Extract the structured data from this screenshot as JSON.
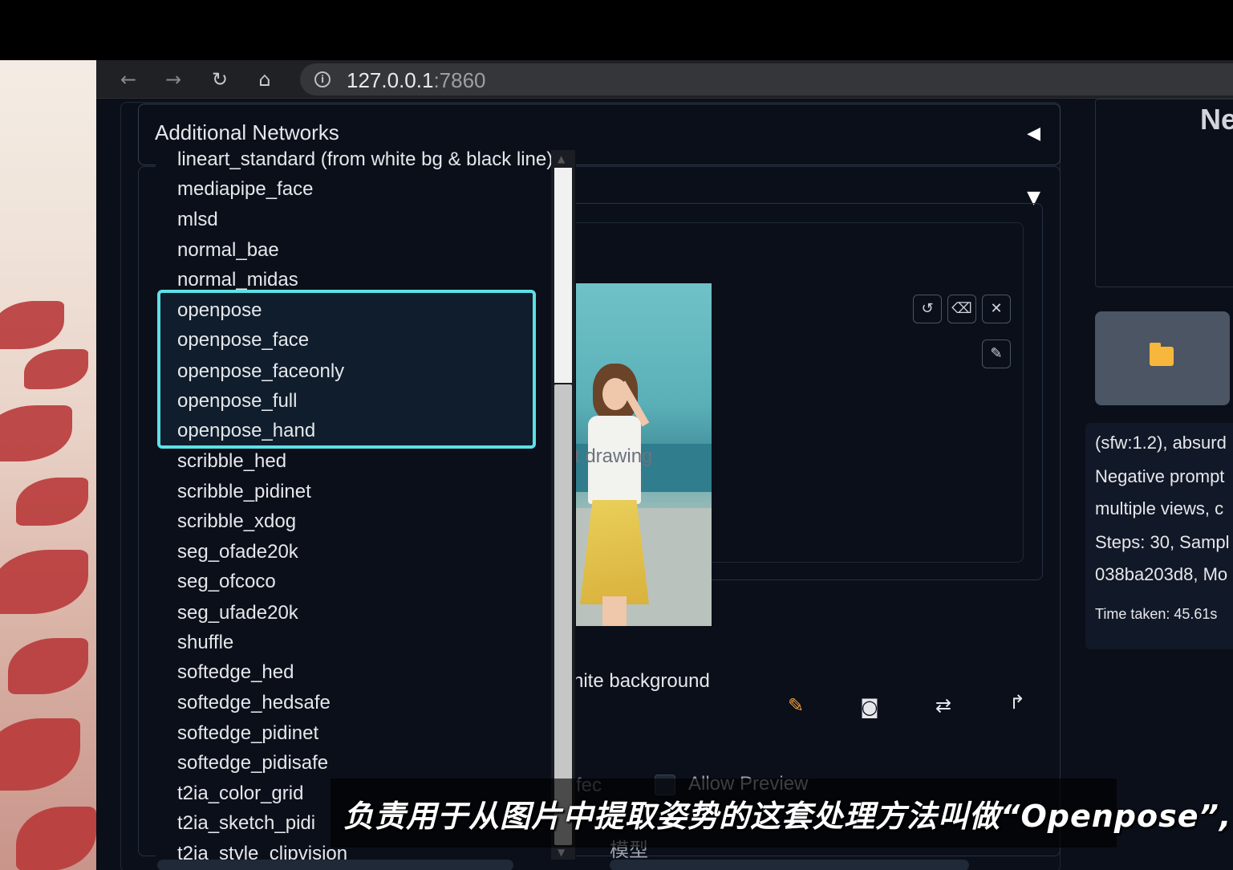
{
  "browser": {
    "url_host": "127.0.0.1",
    "url_port": ":7860"
  },
  "panel": {
    "title": "Additional Networks"
  },
  "dropdown": {
    "items": [
      "lineart_standard (from white bg & black line)",
      "mediapipe_face",
      "mlsd",
      "normal_bae",
      "normal_midas",
      "openpose",
      "openpose_face",
      "openpose_faceonly",
      "openpose_full",
      "openpose_hand",
      "scribble_hed",
      "scribble_pidinet",
      "scribble_xdog",
      "seg_ofade20k",
      "seg_ofcoco",
      "seg_ufade20k",
      "shuffle",
      "softedge_hed",
      "softedge_hedsafe",
      "softedge_pidinet",
      "softedge_pidisafe",
      "t2ia_color_grid",
      "t2ia_sketch_pidi",
      "t2ia_style_clipvision"
    ],
    "highlighted": [
      "openpose",
      "openpose_face",
      "openpose_faceonly",
      "openpose_full",
      "openpose_hand"
    ]
  },
  "controlnet": {
    "ghost_drawing": "t drawing",
    "white_background": "hite background",
    "ghost_effect": "fec",
    "allow_preview": "Allow Preview",
    "model_label": "模型"
  },
  "right_panel": {
    "header_fragment": "Ne",
    "info_lines": [
      "(sfw:1.2), absurd",
      "Negative prompt",
      "multiple views, c",
      "Steps: 30, Sampl",
      "038ba203d8, Mo"
    ],
    "time_taken": "Time taken: 45.61s"
  },
  "subtitle": "负责用于从图片中提取姿势的这套处理方法叫做“Openpose”,",
  "colors": {
    "highlight": "#5ce1e6",
    "folder": "#f6b73c",
    "background": "#0b0f19"
  }
}
